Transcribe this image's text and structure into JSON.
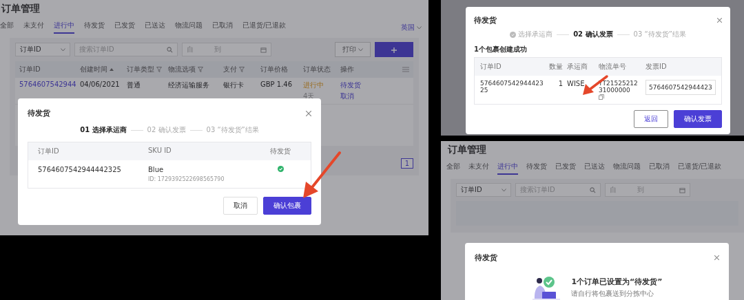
{
  "order_page": {
    "title": "订单管理",
    "tabs": [
      {
        "label": "全部",
        "selected": false
      },
      {
        "label": "未支付",
        "selected": false
      },
      {
        "label": "进行中",
        "selected": true
      },
      {
        "label": "待发货",
        "selected": false
      },
      {
        "label": "已发货",
        "selected": false
      },
      {
        "label": "已送达",
        "selected": false
      },
      {
        "label": "物流问题",
        "selected": false
      },
      {
        "label": "已取消",
        "selected": false
      },
      {
        "label": "已退货/已退款",
        "selected": false
      }
    ],
    "region": "英国",
    "filter": {
      "field": "订单ID",
      "placeholder": "搜索订单ID",
      "date_from": "自",
      "date_to": "到"
    },
    "print_button": "打印",
    "columns": [
      {
        "label": "订单ID",
        "kind": "plain"
      },
      {
        "label": "创建时间",
        "kind": "sort"
      },
      {
        "label": "订单类型",
        "kind": "filter"
      },
      {
        "label": "物流选项",
        "kind": "filter"
      },
      {
        "label": "支付",
        "kind": "filter"
      },
      {
        "label": "订单价格",
        "kind": "plain"
      },
      {
        "label": "订单状态",
        "kind": "plain"
      },
      {
        "label": "操作",
        "kind": "plain"
      }
    ],
    "rows": [
      {
        "order_id": "5764607542944",
        "created": "04/06/2021",
        "type": "普通",
        "shipping": "经济运输服务",
        "payment": "银行卡",
        "price": "GBP 1.46",
        "status": "进行中",
        "status_note": "4天",
        "actions": [
          "待发货",
          "取消"
        ]
      }
    ],
    "pages": [
      {
        "label": "1",
        "selected": true
      }
    ],
    "dialog": {
      "title": "待发货",
      "steps": [
        {
          "label": "01 选择承运商",
          "done": false,
          "selected": true
        },
        {
          "label": "02 确认发票",
          "done": false,
          "selected": false
        },
        {
          "label": "03 “待发货”结果",
          "done": false,
          "selected": false
        }
      ],
      "columns": [
        "订单ID",
        "SKU ID",
        "待发货"
      ],
      "rows": [
        {
          "order_id": "5764607542944442325",
          "sku": "Blue",
          "sku_id": "ID: 1729392522698565790",
          "ready": true
        }
      ],
      "buttons": [
        {
          "label": "取消",
          "kind": "secondary"
        },
        {
          "label": "确认包裹",
          "kind": "primary"
        }
      ]
    }
  },
  "invoice_dialog": {
    "title": "待发货",
    "steps": [
      {
        "label": "选择承运商",
        "done": true,
        "selected": false
      },
      {
        "label": "02 确认发票",
        "done": false,
        "selected": true
      },
      {
        "label": "03 “待发货”结果",
        "done": false,
        "selected": false
      }
    ],
    "message": "1个包裹创建成功",
    "columns": [
      "订单ID",
      "数量",
      "承运商",
      "物流单号",
      "发票ID"
    ],
    "rows": [
      {
        "order_id": "576460754294442325",
        "quantity": "1",
        "carrier": "WISE",
        "tracking": "YT2152521231000000",
        "invoice_id": "5764607542944423"
      }
    ],
    "buttons": [
      {
        "label": "返回",
        "kind": "secondary"
      },
      {
        "label": "确认发票",
        "kind": "primary"
      }
    ]
  },
  "result_page": {
    "title": "订单管理",
    "tabs": [
      {
        "label": "全部",
        "selected": false
      },
      {
        "label": "未支付",
        "selected": false
      },
      {
        "label": "进行中",
        "selected": true
      },
      {
        "label": "待发货",
        "selected": false
      },
      {
        "label": "已发货",
        "selected": false
      },
      {
        "label": "已送达",
        "selected": false
      },
      {
        "label": "物流问题",
        "selected": false
      },
      {
        "label": "已取消",
        "selected": false
      },
      {
        "label": "已退货/已退款",
        "selected": false
      }
    ],
    "filter": {
      "field": "订单ID",
      "placeholder": "搜索订单ID",
      "date_from": "自",
      "date_to": "到"
    },
    "dialog": {
      "title": "待发货",
      "message": "1个订单已设置为“待发货”",
      "hint": "请自行将包裹送到分拣中心"
    }
  }
}
